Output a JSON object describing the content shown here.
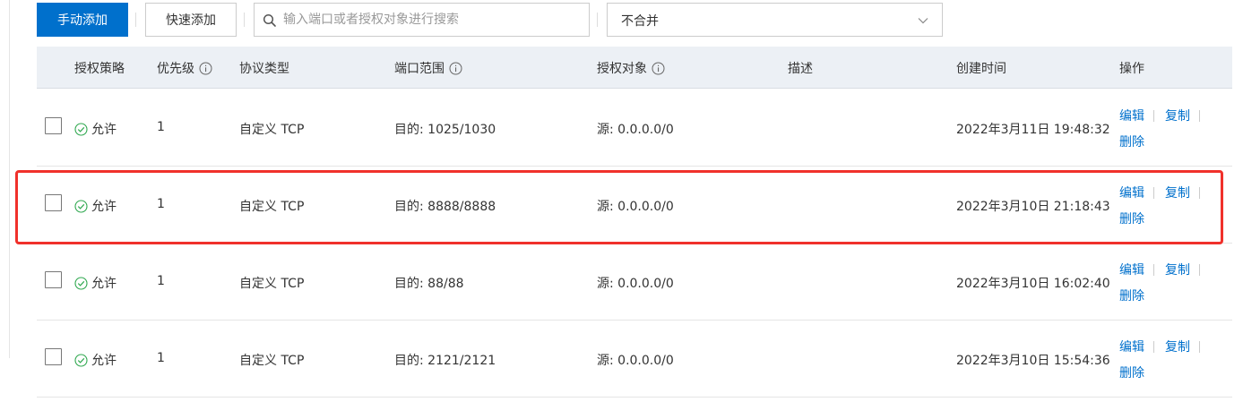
{
  "toolbar": {
    "manual_add_label": "手动添加",
    "quick_add_label": "快速添加",
    "search_placeholder": "输入端口或者授权对象进行搜索",
    "merge_select_value": "不合并"
  },
  "table": {
    "columns": {
      "policy": "授权策略",
      "priority": "优先级",
      "protocol": "协议类型",
      "port_range": "端口范围",
      "auth_object": "授权对象",
      "description": "描述",
      "created_time": "创建时间",
      "actions": "操作"
    },
    "actions": {
      "edit": "编辑",
      "copy": "复制",
      "delete": "删除"
    },
    "rows": [
      {
        "policy": "允许",
        "priority": "1",
        "protocol": "自定义 TCP",
        "port_range": "目的: 1025/1030",
        "auth_object": "源: 0.0.0.0/0",
        "description": "",
        "created_time": "2022年3月11日 19:48:32"
      },
      {
        "policy": "允许",
        "priority": "1",
        "protocol": "自定义 TCP",
        "port_range": "目的: 8888/8888",
        "auth_object": "源: 0.0.0.0/0",
        "description": "",
        "created_time": "2022年3月10日 21:18:43"
      },
      {
        "policy": "允许",
        "priority": "1",
        "protocol": "自定义 TCP",
        "port_range": "目的: 88/88",
        "auth_object": "源: 0.0.0.0/0",
        "description": "",
        "created_time": "2022年3月10日 16:02:40"
      },
      {
        "policy": "允许",
        "priority": "1",
        "protocol": "自定义 TCP",
        "port_range": "目的: 2121/2121",
        "auth_object": "源: 0.0.0.0/0",
        "description": "",
        "created_time": "2022年3月10日 15:54:36"
      }
    ]
  },
  "icons": {
    "search": "search-icon",
    "dropdown": "chevron-down-icon",
    "info": "info-icon",
    "allow_status": "check-circle-icon"
  },
  "colors": {
    "primary": "#0070cc",
    "allow_green": "#2fa84f",
    "highlight_red": "#f0312b",
    "header_bg": "#ecf0f5"
  }
}
